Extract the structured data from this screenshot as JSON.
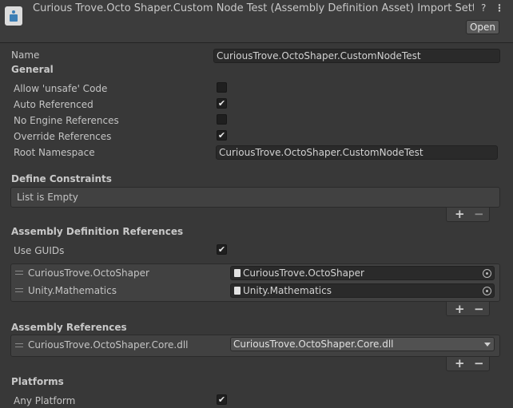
{
  "header": {
    "title": "Curious Trove.Octo Shaper.Custom Node Test (Assembly Definition Asset) Import Settings",
    "open_label": "Open",
    "help_icon": "help-icon",
    "menu_icon": "kebab-menu-icon"
  },
  "name_label": "Name",
  "name_value": "CuriousTrove.OctoShaper.CustomNodeTest",
  "general": {
    "title": "General",
    "allow_unsafe_label": "Allow 'unsafe' Code",
    "allow_unsafe": false,
    "auto_referenced_label": "Auto Referenced",
    "auto_referenced": true,
    "no_engine_refs_label": "No Engine References",
    "no_engine_refs": false,
    "override_refs_label": "Override References",
    "override_refs": true,
    "root_ns_label": "Root Namespace",
    "root_ns_value": "CuriousTrove.OctoShaper.CustomNodeTest"
  },
  "define_constraints": {
    "title": "Define Constraints",
    "empty_text": "List is Empty",
    "add": "+",
    "remove": "−"
  },
  "asmdef_refs": {
    "title": "Assembly Definition References",
    "use_guids_label": "Use GUIDs",
    "use_guids": true,
    "items": [
      {
        "label": "CuriousTrove.OctoShaper",
        "value": "CuriousTrove.OctoShaper"
      },
      {
        "label": "Unity.Mathematics",
        "value": "Unity.Mathematics"
      }
    ],
    "add": "+",
    "remove": "−"
  },
  "assembly_refs": {
    "title": "Assembly References",
    "items": [
      {
        "label": "CuriousTrove.OctoShaper.Core.dll",
        "value": "CuriousTrove.OctoShaper.Core.dll"
      }
    ],
    "add": "+",
    "remove": "−"
  },
  "platforms": {
    "title": "Platforms",
    "any_platform_label": "Any Platform",
    "any_platform": true
  },
  "check_glyph": "✔"
}
